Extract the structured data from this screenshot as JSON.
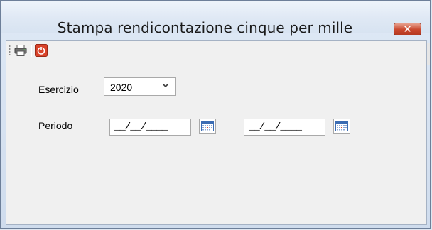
{
  "window": {
    "title": "Stampa rendicontazione cinque per mille",
    "close_glyph": "✕"
  },
  "toolbar": {
    "items": [
      {
        "name": "print-icon"
      },
      {
        "name": "power-off-icon"
      }
    ]
  },
  "form": {
    "esercizio": {
      "label": "Esercizio",
      "selected": "2020"
    },
    "periodo": {
      "label": "Periodo",
      "from_value": "__/__/____",
      "to_value": "__/__/____"
    }
  },
  "colors": {
    "close_button": "#c9472d",
    "client_background": "#f0f0f0",
    "titlebar": "#dfe8f4",
    "power_icon": "#d9432a"
  }
}
